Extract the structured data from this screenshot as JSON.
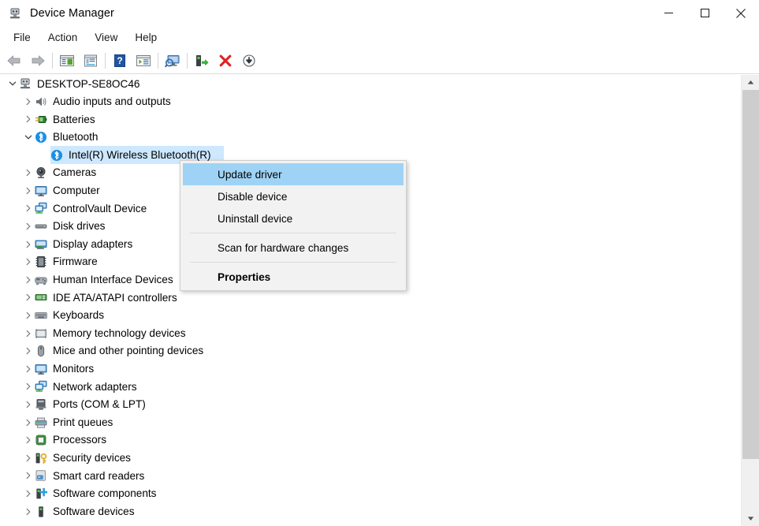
{
  "window": {
    "title": "Device Manager",
    "icon": "device-manager-icon",
    "controls": [
      {
        "name": "minimize",
        "glyph": "minimize-icon"
      },
      {
        "name": "maximize",
        "glyph": "maximize-icon"
      },
      {
        "name": "close",
        "glyph": "close-icon"
      }
    ]
  },
  "menubar": {
    "items": [
      {
        "label": "File"
      },
      {
        "label": "Action"
      },
      {
        "label": "View"
      },
      {
        "label": "Help"
      }
    ]
  },
  "toolbar": {
    "buttons": [
      {
        "name": "back-button",
        "icon": "back-arrow-icon"
      },
      {
        "name": "forward-button",
        "icon": "forward-arrow-icon"
      },
      {
        "name": "show-hide-console-tree-button",
        "icon": "console-tree-icon"
      },
      {
        "name": "properties-button",
        "icon": "properties-window-icon"
      },
      {
        "name": "help-button",
        "icon": "help-question-icon"
      },
      {
        "name": "show-hide-action-pane-button",
        "icon": "action-pane-icon"
      },
      {
        "name": "scan-for-hardware-changes-button",
        "icon": "scan-monitor-icon"
      },
      {
        "name": "update-driver-button",
        "icon": "update-driver-icon"
      },
      {
        "name": "uninstall-device-button",
        "icon": "red-x-icon"
      },
      {
        "name": "disable-device-button",
        "icon": "down-arrow-circle-icon"
      }
    ]
  },
  "tree": {
    "rows": [
      {
        "label": "DESKTOP-SE8OC46",
        "depth": 0,
        "expander": "expanded",
        "icon": "computer-root-icon",
        "selected": false
      },
      {
        "label": "Audio inputs and outputs",
        "depth": 1,
        "expander": "collapsed",
        "icon": "speaker-icon",
        "selected": false
      },
      {
        "label": "Batteries",
        "depth": 1,
        "expander": "collapsed",
        "icon": "battery-icon",
        "selected": false
      },
      {
        "label": "Bluetooth",
        "depth": 1,
        "expander": "expanded",
        "icon": "bluetooth-icon",
        "selected": false
      },
      {
        "label": "Intel(R) Wireless Bluetooth(R)",
        "depth": 2,
        "expander": "none",
        "icon": "bluetooth-icon",
        "selected": true
      },
      {
        "label": "Cameras",
        "depth": 1,
        "expander": "collapsed",
        "icon": "camera-icon",
        "selected": false
      },
      {
        "label": "Computer",
        "depth": 1,
        "expander": "collapsed",
        "icon": "monitor-icon",
        "selected": false
      },
      {
        "label": "ControlVault Device",
        "depth": 1,
        "expander": "collapsed",
        "icon": "network-device-icon",
        "selected": false
      },
      {
        "label": "Disk drives",
        "depth": 1,
        "expander": "collapsed",
        "icon": "disk-drive-icon",
        "selected": false
      },
      {
        "label": "Display adapters",
        "depth": 1,
        "expander": "collapsed",
        "icon": "display-adapter-icon",
        "selected": false
      },
      {
        "label": "Firmware",
        "depth": 1,
        "expander": "collapsed",
        "icon": "firmware-chip-icon",
        "selected": false
      },
      {
        "label": "Human Interface Devices",
        "depth": 1,
        "expander": "collapsed",
        "icon": "hid-gamepad-icon",
        "selected": false
      },
      {
        "label": "IDE ATA/ATAPI controllers",
        "depth": 1,
        "expander": "collapsed",
        "icon": "ide-controller-icon",
        "selected": false
      },
      {
        "label": "Keyboards",
        "depth": 1,
        "expander": "collapsed",
        "icon": "keyboard-icon",
        "selected": false
      },
      {
        "label": "Memory technology devices",
        "depth": 1,
        "expander": "collapsed",
        "icon": "memory-device-icon",
        "selected": false
      },
      {
        "label": "Mice and other pointing devices",
        "depth": 1,
        "expander": "collapsed",
        "icon": "mouse-icon",
        "selected": false
      },
      {
        "label": "Monitors",
        "depth": 1,
        "expander": "collapsed",
        "icon": "monitor-icon",
        "selected": false
      },
      {
        "label": "Network adapters",
        "depth": 1,
        "expander": "collapsed",
        "icon": "network-device-icon",
        "selected": false
      },
      {
        "label": "Ports (COM & LPT)",
        "depth": 1,
        "expander": "collapsed",
        "icon": "port-icon",
        "selected": false
      },
      {
        "label": "Print queues",
        "depth": 1,
        "expander": "collapsed",
        "icon": "printer-icon",
        "selected": false
      },
      {
        "label": "Processors",
        "depth": 1,
        "expander": "collapsed",
        "icon": "processor-icon",
        "selected": false
      },
      {
        "label": "Security devices",
        "depth": 1,
        "expander": "collapsed",
        "icon": "security-key-icon",
        "selected": false
      },
      {
        "label": "Smart card readers",
        "depth": 1,
        "expander": "collapsed",
        "icon": "smart-card-reader-icon",
        "selected": false
      },
      {
        "label": "Software components",
        "depth": 1,
        "expander": "collapsed",
        "icon": "software-component-icon",
        "selected": false
      },
      {
        "label": "Software devices",
        "depth": 1,
        "expander": "collapsed",
        "icon": "software-device-icon",
        "selected": false
      }
    ]
  },
  "context_menu": {
    "items": [
      {
        "label": "Update driver",
        "highlighted": true,
        "bold": false,
        "separator_after": false
      },
      {
        "label": "Disable device",
        "highlighted": false,
        "bold": false,
        "separator_after": false
      },
      {
        "label": "Uninstall device",
        "highlighted": false,
        "bold": false,
        "separator_after": true
      },
      {
        "label": "Scan for hardware changes",
        "highlighted": false,
        "bold": false,
        "separator_after": true
      },
      {
        "label": "Properties",
        "highlighted": false,
        "bold": true,
        "separator_after": false
      }
    ]
  },
  "scrollbar": {
    "up_arrow": "scroll-up-arrow-icon",
    "down_arrow": "scroll-down-arrow-icon"
  },
  "colors": {
    "selection": "#cde8ff",
    "menu_highlight": "#9fd3f5",
    "menu_bg": "#f2f2f2",
    "scrollbar_thumb": "#cdcdcd"
  }
}
